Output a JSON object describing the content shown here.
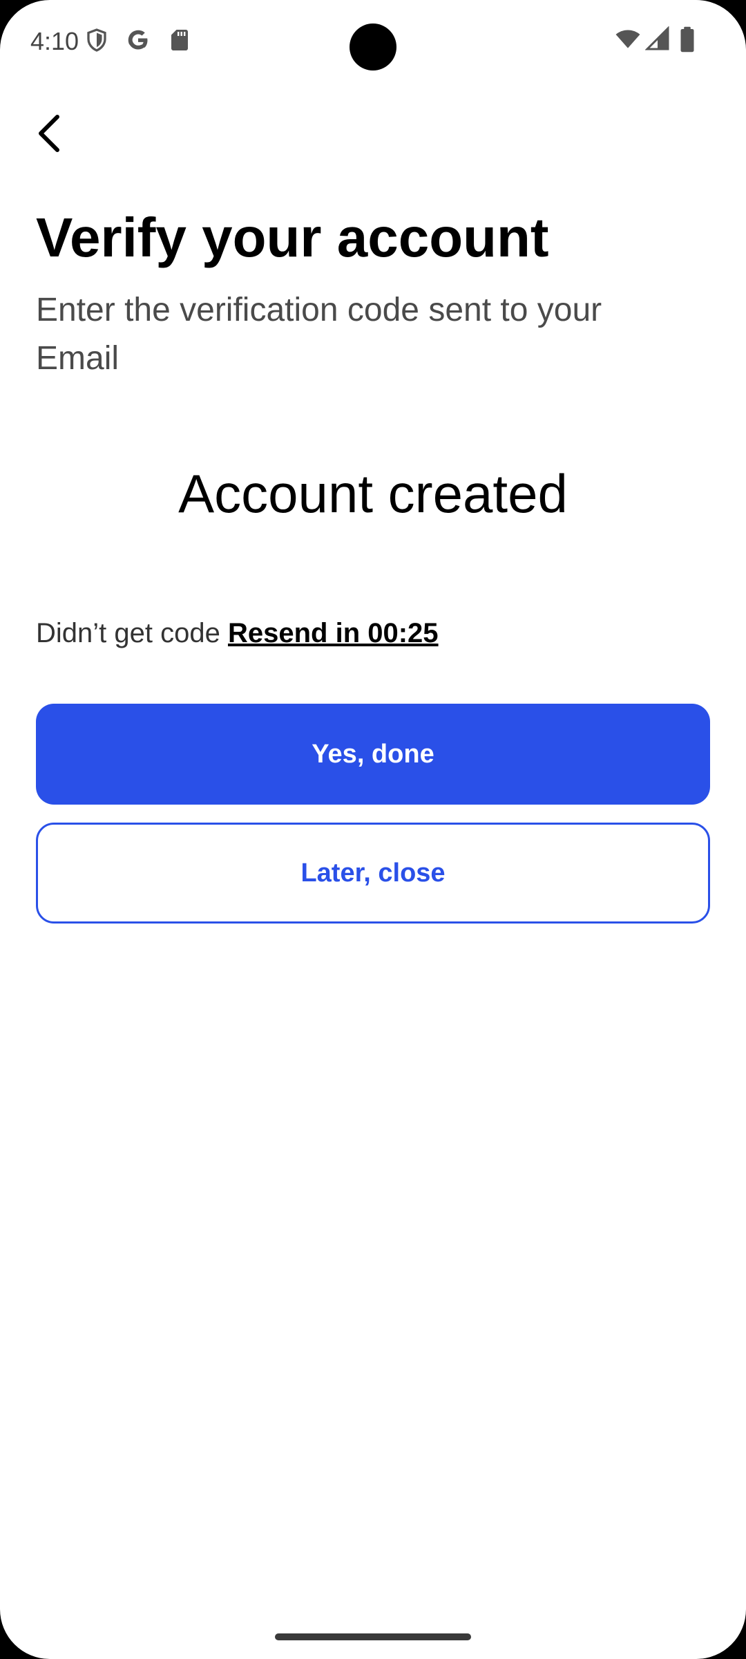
{
  "status_bar": {
    "time": "4:10",
    "icons_left": [
      "shield-icon",
      "google-icon",
      "sd-card-icon"
    ],
    "icons_right": [
      "wifi-icon",
      "signal-icon",
      "battery-icon"
    ]
  },
  "header": {
    "back_icon": "chevron-left-icon"
  },
  "title": "Verify your account",
  "subtitle": "Enter the verification code sent to your Email",
  "status_message": "Account created",
  "resend": {
    "prompt": "Didn’t get code",
    "link_label": "Resend in 00:25"
  },
  "actions": {
    "primary_label": "Yes, done",
    "secondary_label": "Later, close"
  },
  "colors": {
    "accent": "#2a50e8",
    "background": "#ffffff",
    "title": "#000000",
    "subtitle": "#4a4a4a"
  }
}
